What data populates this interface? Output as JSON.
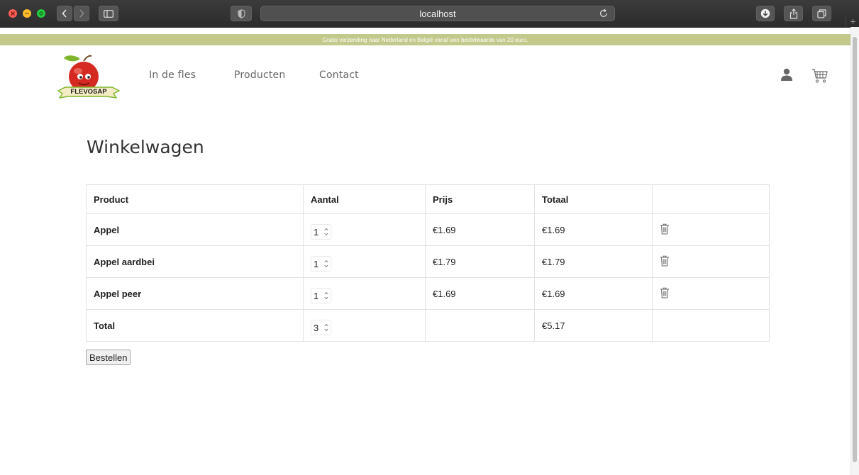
{
  "browser": {
    "url": "localhost"
  },
  "promo": {
    "text": "Gratis verzending naar Nederland en België vanaf een bestelwaarde van 20 euro."
  },
  "brand": {
    "logo_text": "FLEVOSAP",
    "colors": {
      "promo_bg": "#c3c98a",
      "apple_red": "#d42a22",
      "leaf_green": "#7fb52c"
    }
  },
  "nav": {
    "items": [
      {
        "label": "In de fles"
      },
      {
        "label": "Producten"
      },
      {
        "label": "Contact"
      }
    ],
    "icons": [
      "user-icon",
      "cart-icon"
    ]
  },
  "cart": {
    "title": "Winkelwagen",
    "columns": [
      "Product",
      "Aantal",
      "Prijs",
      "Totaal",
      ""
    ],
    "rows": [
      {
        "product": "Appel",
        "quantity": "1",
        "price": "€1.69",
        "total": "€1.69"
      },
      {
        "product": "Appel aardbei",
        "quantity": "1",
        "price": "€1.79",
        "total": "€1.79"
      },
      {
        "product": "Appel peer",
        "quantity": "1",
        "price": "€1.69",
        "total": "€1.69"
      }
    ],
    "summary": {
      "label": "Total",
      "quantity": "3",
      "total": "€5.17"
    },
    "order_button": "Bestellen"
  }
}
